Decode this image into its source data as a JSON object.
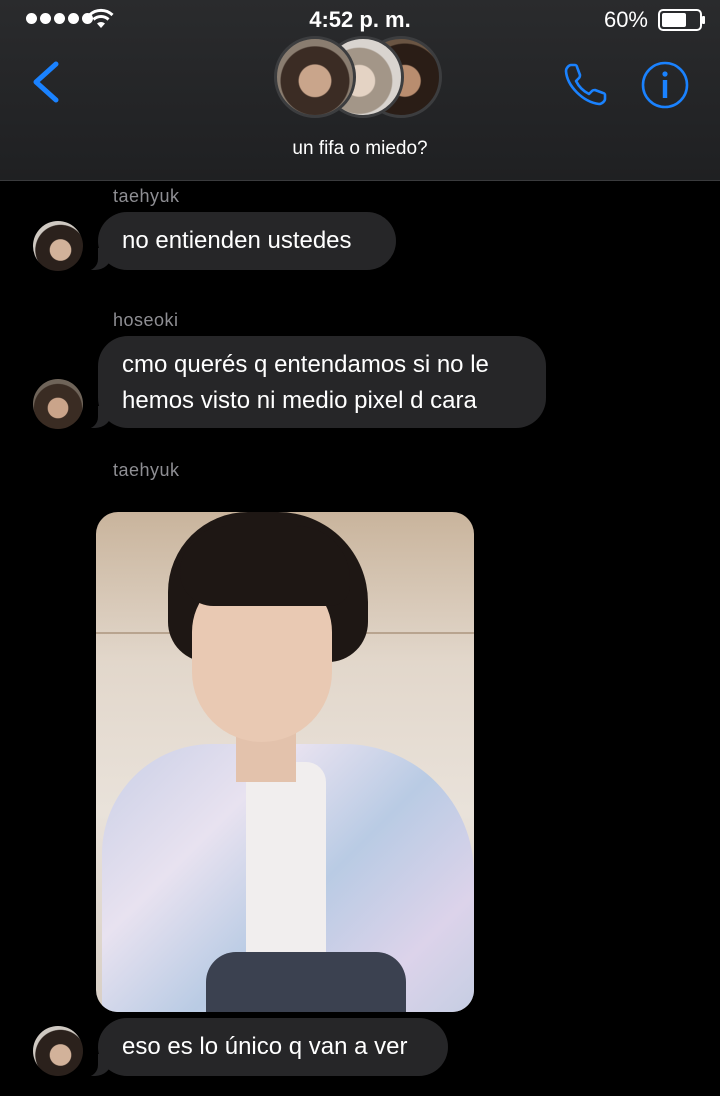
{
  "status_bar": {
    "time": "4:52 p. m.",
    "battery": "60%"
  },
  "header": {
    "group_name": "un fifa o miedo?"
  },
  "messages": [
    {
      "sender": "taehyuk",
      "text": "no entienden ustedes"
    },
    {
      "sender": "hoseoki",
      "line1": "cmo querés q entendamos si no le",
      "line2": "hemos visto ni medio pixel d cara"
    },
    {
      "sender": "taehyuk",
      "image": "photo-of-person"
    },
    {
      "text": "eso es lo único q van a ver"
    }
  ],
  "colors": {
    "accent": "#1a82ff",
    "bubble": "#262628",
    "sender": "#8e8e93",
    "background": "#000000"
  }
}
